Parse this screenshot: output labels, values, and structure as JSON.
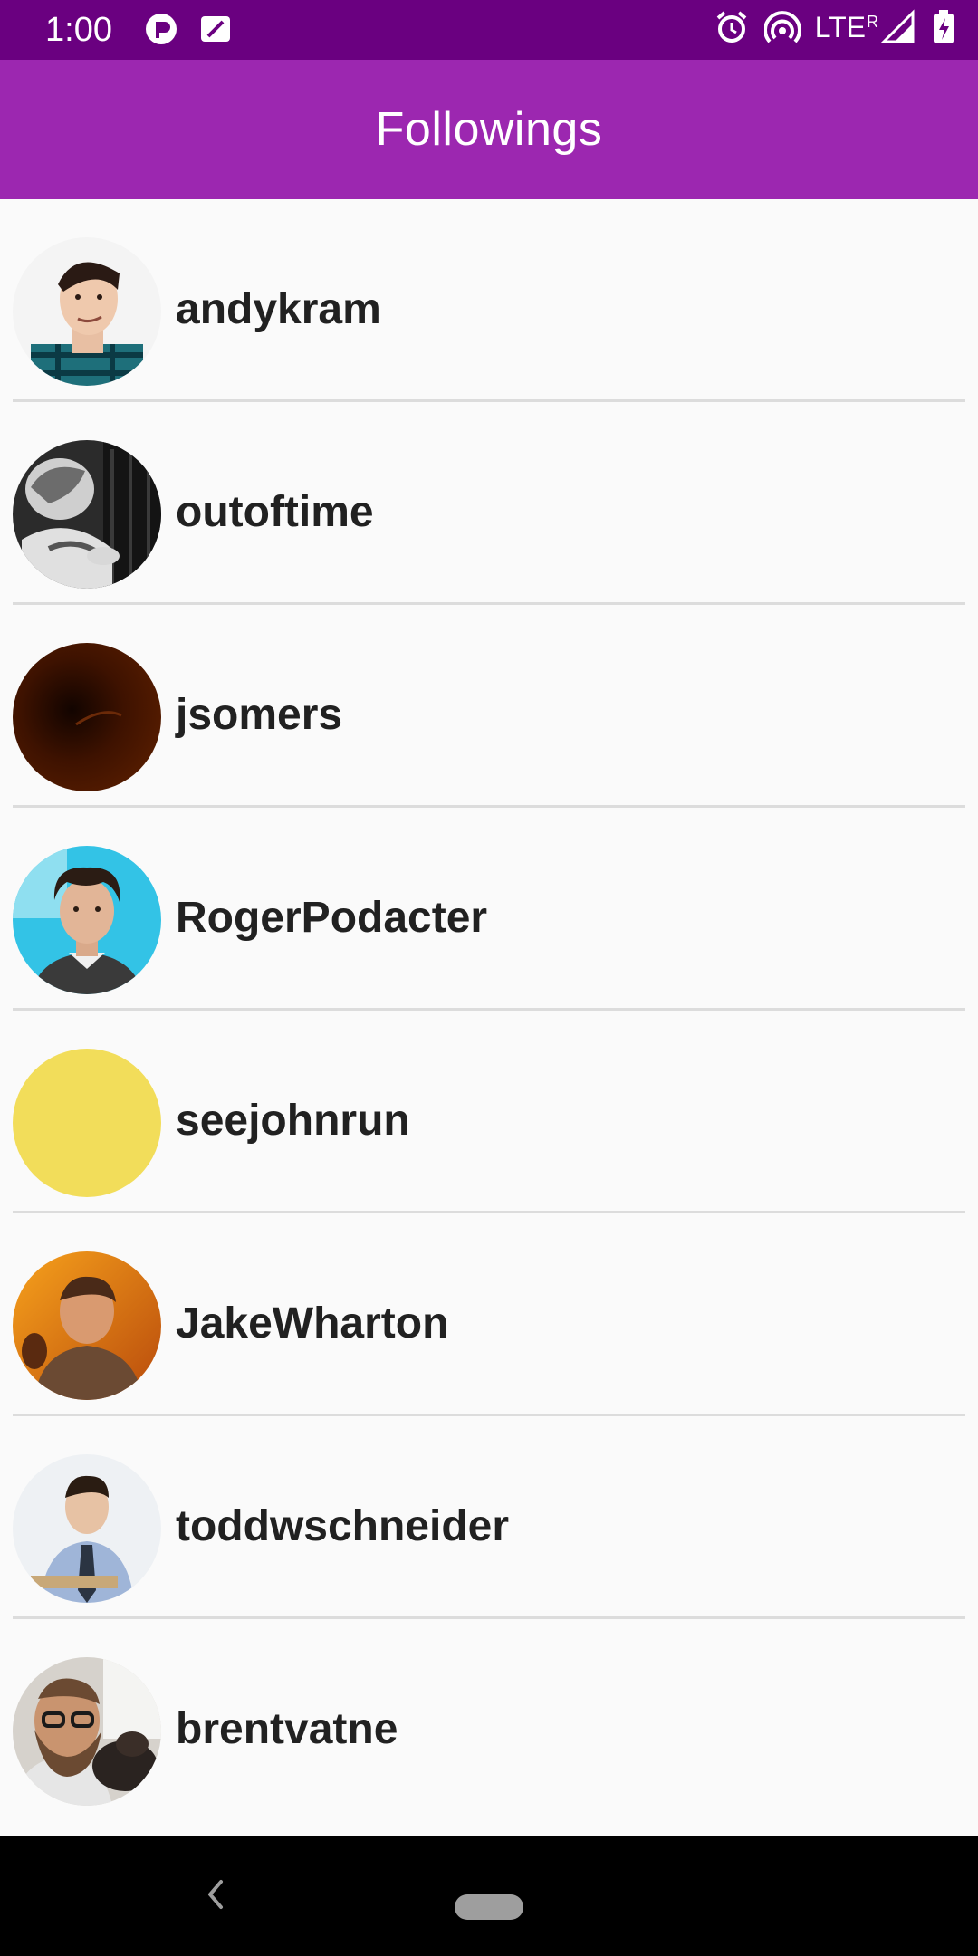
{
  "status_bar": {
    "time": "1:00",
    "network": "LTE",
    "roaming": "R",
    "icons": [
      "data-saver-icon",
      "sim-card-icon",
      "alarm-icon",
      "hotspot-icon",
      "signal-icon",
      "battery-charging-icon"
    ]
  },
  "app_bar": {
    "title": "Followings"
  },
  "followings": [
    {
      "username": "andykram",
      "avatar": "photo-portrait-plaid-shirt"
    },
    {
      "username": "outoftime",
      "avatar": "photo-black-and-white"
    },
    {
      "username": "jsomers",
      "avatar": "dark-red-abstract"
    },
    {
      "username": "RogerPodacter",
      "avatar": "photo-portrait-blue-background"
    },
    {
      "username": "seejohnrun",
      "avatar": "solid-yellow"
    },
    {
      "username": "JakeWharton",
      "avatar": "photo-portrait-orange-light"
    },
    {
      "username": "toddwschneider",
      "avatar": "photo-portrait-shirt-tie"
    },
    {
      "username": "brentvatne",
      "avatar": "photo-selfie-with-dog"
    }
  ],
  "colors": {
    "status_bar": "#6a0080",
    "app_bar": "#9c27b0",
    "background": "#fafafa",
    "divider": "#dcdcdc",
    "username_text": "#212121"
  },
  "nav_bar": {
    "icons": [
      "back-icon",
      "home-pill-icon"
    ]
  }
}
